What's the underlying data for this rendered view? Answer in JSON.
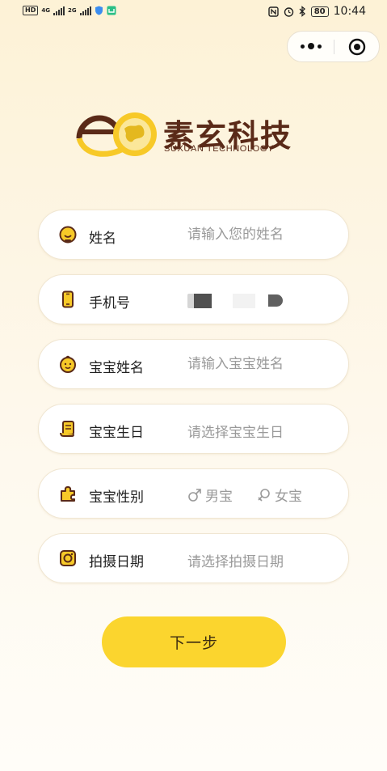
{
  "status_bar": {
    "hd_label": "HD",
    "network_1": "4G",
    "network_2": "2G",
    "battery": "80",
    "time": "10:44"
  },
  "logo": {
    "name_cn": "素玄科技",
    "name_en": "SUXUAN TECHNOLOGY",
    "brand_brown": "#5a2a18",
    "brand_yellow": "#f7c928"
  },
  "form": {
    "name": {
      "icon": "smile-face-icon",
      "label": "姓名",
      "placeholder": "请输入您的姓名"
    },
    "phone": {
      "icon": "mobile-phone-icon",
      "label": "手机号"
    },
    "baby_name": {
      "icon": "baby-face-icon",
      "label": "宝宝姓名",
      "placeholder": "请输入宝宝姓名"
    },
    "baby_birthday": {
      "icon": "scroll-icon",
      "label": "宝宝生日",
      "placeholder": "请选择宝宝生日"
    },
    "baby_gender": {
      "icon": "puzzle-icon",
      "label": "宝宝性别",
      "male": {
        "icon": "male-symbol-icon",
        "label": "男宝"
      },
      "female": {
        "icon": "female-symbol-icon",
        "label": "女宝"
      }
    },
    "shoot_date": {
      "icon": "camera-icon",
      "label": "拍摄日期",
      "placeholder": "请选择拍摄日期"
    }
  },
  "next_button": {
    "label": "下一步",
    "color": "#fbd52e"
  }
}
